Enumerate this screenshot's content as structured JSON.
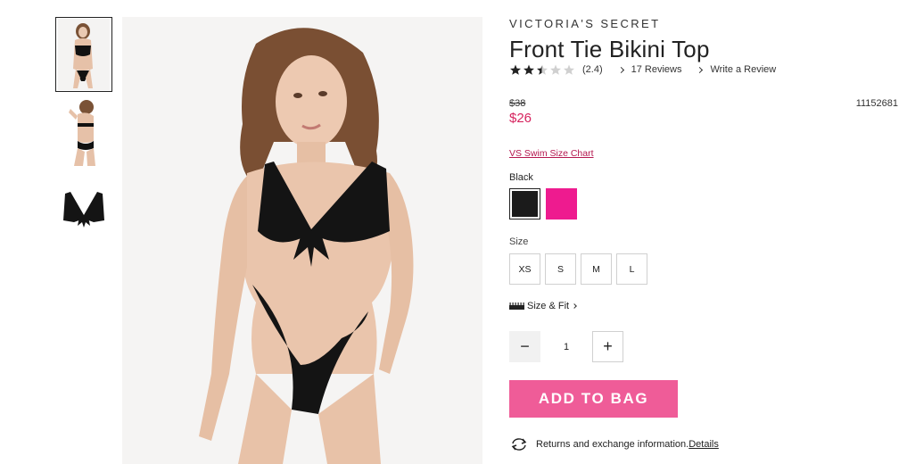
{
  "gallery": {
    "thumbnails": [
      "front-view",
      "back-view",
      "product-flat"
    ],
    "active_index": 0
  },
  "product": {
    "brand": "VICTORIA'S SECRET",
    "title": "Front Tie Bikini Top",
    "rating": 2.4,
    "rating_text": "(2.4)",
    "stars_max": 5,
    "reviews_link": "17 Reviews",
    "write_review_link": "Write a Review",
    "price_original": "$38",
    "price_sale": "$26",
    "sku": "11152681",
    "size_chart_link": "VS Swim Size Chart"
  },
  "color": {
    "label": "Black",
    "options": [
      {
        "name": "Black",
        "hex": "#1b1b1b",
        "selected": true
      },
      {
        "name": "Pink",
        "hex": "#ee1b8f",
        "selected": false
      }
    ]
  },
  "size": {
    "label": "Size",
    "options": [
      "XS",
      "S",
      "M",
      "L"
    ]
  },
  "size_fit": {
    "label": "Size & Fit"
  },
  "quantity": {
    "minus": "−",
    "value": "1",
    "plus": "+"
  },
  "cta": {
    "add_to_bag": "ADD TO BAG"
  },
  "returns": {
    "text": "Returns and exchange information.",
    "link": "Details"
  },
  "colors": {
    "accent_pink": "#ef5c98",
    "sale_price": "#d6235e",
    "link": "#b5174f"
  }
}
